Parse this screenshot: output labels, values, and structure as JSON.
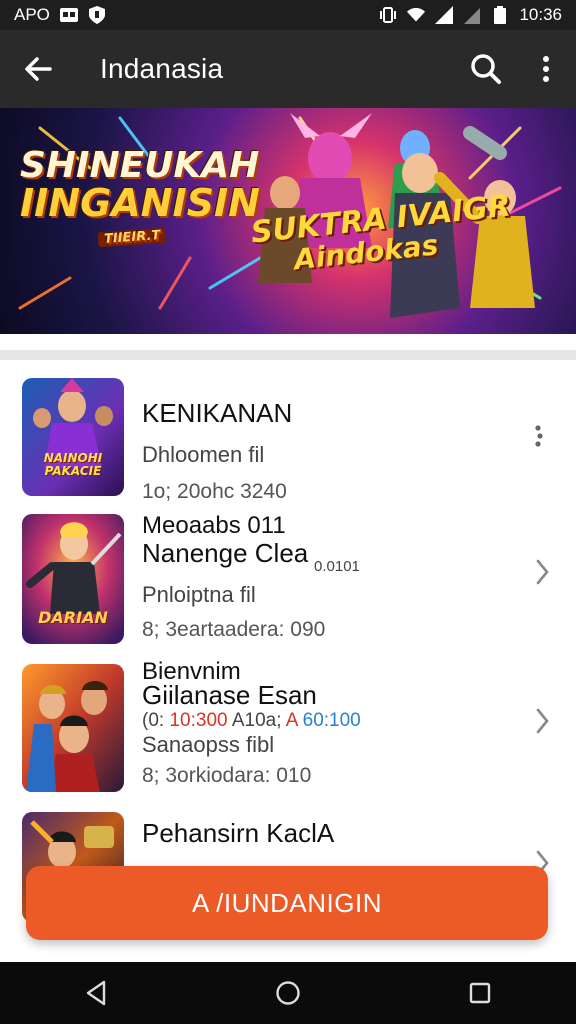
{
  "status_bar": {
    "carrier": "APO",
    "time": "10:36"
  },
  "app_bar": {
    "title": "Indanasia"
  },
  "banner": {
    "title_line1": "SHINEUKAH",
    "title_line2": "IINGANISIN",
    "title_small": "TIIEIR.T",
    "subtitle_line1": "SUKTRA IVAIGR",
    "subtitle_line2": "Aindokas"
  },
  "list": {
    "items": [
      {
        "title": "KENIKANAN",
        "subtitle": "Dhloomen fil",
        "meta": "1o; 20ohc 3240",
        "thumb_text": "NAINOHI PAKACIE",
        "action": "more"
      },
      {
        "title": "Meoaabs 011",
        "title2": "Nanenge Clea",
        "extra": "0.0101",
        "subtitle": "Pnloiptna fil",
        "meta": "8; 3eartaadera: 090",
        "thumb_text": "DARIAN",
        "action": "chevron"
      },
      {
        "title": "Bienvnim",
        "title2": "Giilanase Esan",
        "price_line": [
          "(0:",
          "10:300",
          "A10a;",
          "A",
          "60:100"
        ],
        "subtitle": "Sanaopss fibl",
        "meta": "8; 3orkiodara: 010",
        "action": "chevron"
      },
      {
        "title": "Pehansirn KaclA",
        "action": "chevron"
      }
    ]
  },
  "fab": {
    "label": "A /IUNDANIGIN"
  },
  "colors": {
    "accent": "#ec5a27",
    "app_bar": "#2a2a2a",
    "status_bar": "#1e1e1e",
    "nav_bar": "#0b0b0b"
  }
}
